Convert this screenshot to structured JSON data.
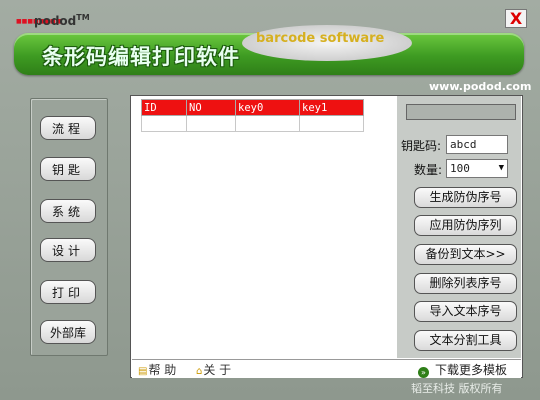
{
  "header": {
    "brand": "podod",
    "brand_tm": "TM",
    "logo_dots": "■■■■■■■■",
    "title": "条形码编辑打印软件",
    "subtitle": "barcode software",
    "url": "www.podod.com",
    "close_symbol": "X"
  },
  "nav": {
    "items": [
      {
        "label": "流程"
      },
      {
        "label": "钥匙"
      },
      {
        "label": "系统"
      },
      {
        "label": "设计"
      },
      {
        "label": "打印"
      },
      {
        "label": "外部库"
      }
    ]
  },
  "grid": {
    "columns": [
      "ID",
      "NO",
      "key0",
      "key1"
    ],
    "rows": [
      [
        "",
        "",
        "",
        ""
      ]
    ]
  },
  "panel": {
    "key_label": "钥匙码:",
    "key_value": "abcd",
    "count_label": "数量:",
    "count_value": "100",
    "buttons": [
      {
        "label": "生成防伪序号"
      },
      {
        "label": "应用防伪序列"
      },
      {
        "label": "备份到文本>>"
      },
      {
        "label": "删除列表序号"
      },
      {
        "label": "导入文本序号"
      },
      {
        "label": "文本分割工具"
      }
    ]
  },
  "footer": {
    "help_label": "帮 助",
    "about_label": "关 于",
    "download_label": "下载更多模板",
    "copyright": "韬至科技 版权所有"
  },
  "colors": {
    "banner": "#3e9b22",
    "grid_header": "#ee1111",
    "accent_gold": "#d6b020"
  }
}
